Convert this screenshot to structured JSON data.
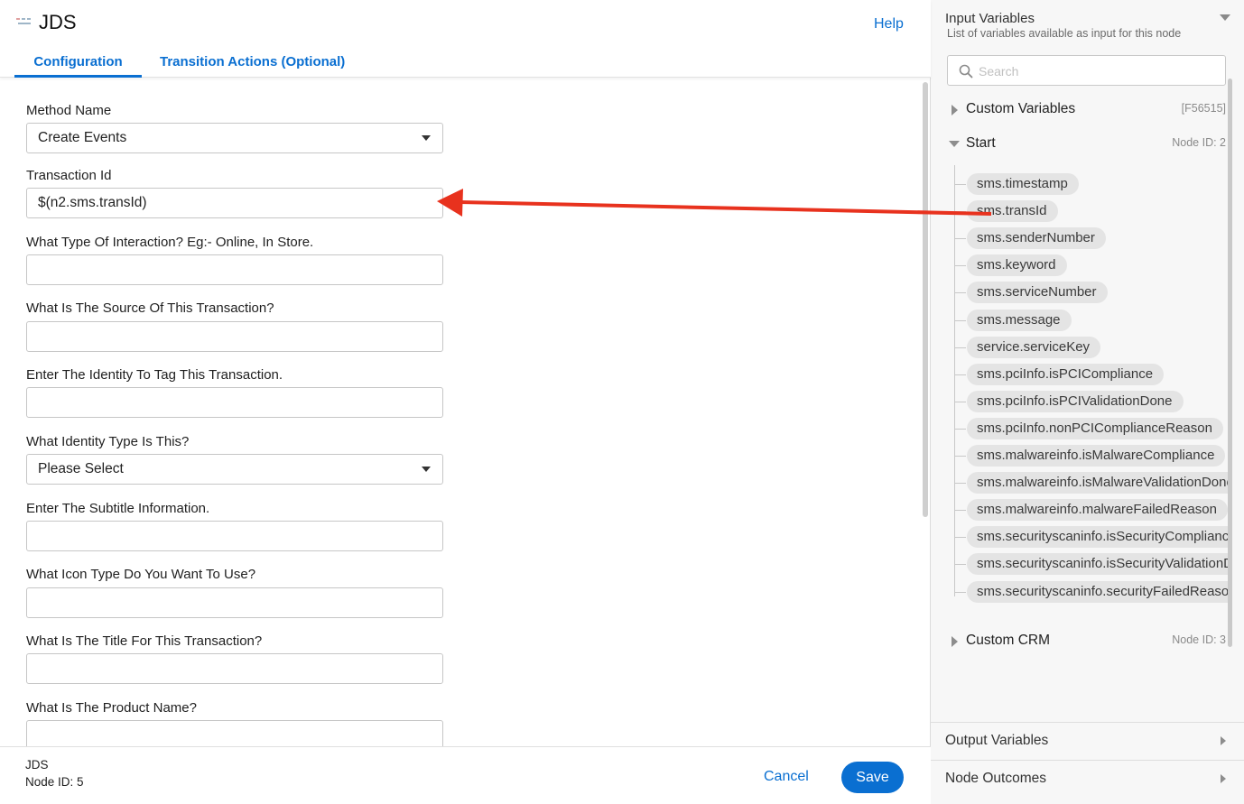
{
  "header": {
    "title": "JDS",
    "help_label": "Help",
    "tabs": [
      {
        "label": "Configuration",
        "active": true
      },
      {
        "label": "Transition Actions (Optional)",
        "active": false
      }
    ]
  },
  "form": {
    "method_name": {
      "label": "Method Name",
      "value": "Create Events"
    },
    "transaction_id": {
      "label": "Transaction Id",
      "value": "$(n2.sms.transId)"
    },
    "interaction_type": {
      "label": "What Type Of Interaction? Eg:- Online, In Store.",
      "value": ""
    },
    "source": {
      "label": "What Is The Source Of This Transaction?",
      "value": ""
    },
    "identity": {
      "label": "Enter The Identity To Tag This Transaction.",
      "value": ""
    },
    "identity_type": {
      "label": "What Identity Type Is This?",
      "value": "Please Select"
    },
    "subtitle": {
      "label": "Enter The Subtitle Information.",
      "value": ""
    },
    "icon_type": {
      "label": "What Icon Type Do You Want To Use?",
      "value": ""
    },
    "title": {
      "label": "What Is The Title For This Transaction?",
      "value": ""
    },
    "product_name": {
      "label": "What Is The Product Name?",
      "value": ""
    }
  },
  "footer": {
    "node_name": "JDS",
    "node_id": "Node ID: 5",
    "cancel_label": "Cancel",
    "save_label": "Save"
  },
  "input_variables": {
    "title": "Input Variables",
    "subtitle": "List of variables available as input for this node",
    "search_placeholder": "Search",
    "groups": [
      {
        "label": "Custom Variables",
        "meta": "[F56515]",
        "expanded": false
      },
      {
        "label": "Start",
        "meta": "Node ID: 2",
        "expanded": true
      },
      {
        "label": "Custom CRM",
        "meta": "Node ID: 3",
        "expanded": false
      }
    ],
    "start_variables": [
      "sms.timestamp",
      "sms.transId",
      "sms.senderNumber",
      "sms.keyword",
      "sms.serviceNumber",
      "sms.message",
      "service.serviceKey",
      "sms.pciInfo.isPCICompliance",
      "sms.pciInfo.isPCIValidationDone",
      "sms.pciInfo.nonPCIComplianceReason",
      "sms.malwareinfo.isMalwareCompliance",
      "sms.malwareinfo.isMalwareValidationDone",
      "sms.malwareinfo.malwareFailedReason",
      "sms.securityscaninfo.isSecurityCompliance",
      "sms.securityscaninfo.isSecurityValidationDone",
      "sms.securityscaninfo.securityFailedReason"
    ]
  },
  "output_variables": {
    "label": "Output Variables"
  },
  "node_outcomes": {
    "label": "Node Outcomes"
  },
  "colors": {
    "accent": "#0a6fd1",
    "annotation_arrow": "#e8321e",
    "pill_bg": "#e4e4e4"
  }
}
